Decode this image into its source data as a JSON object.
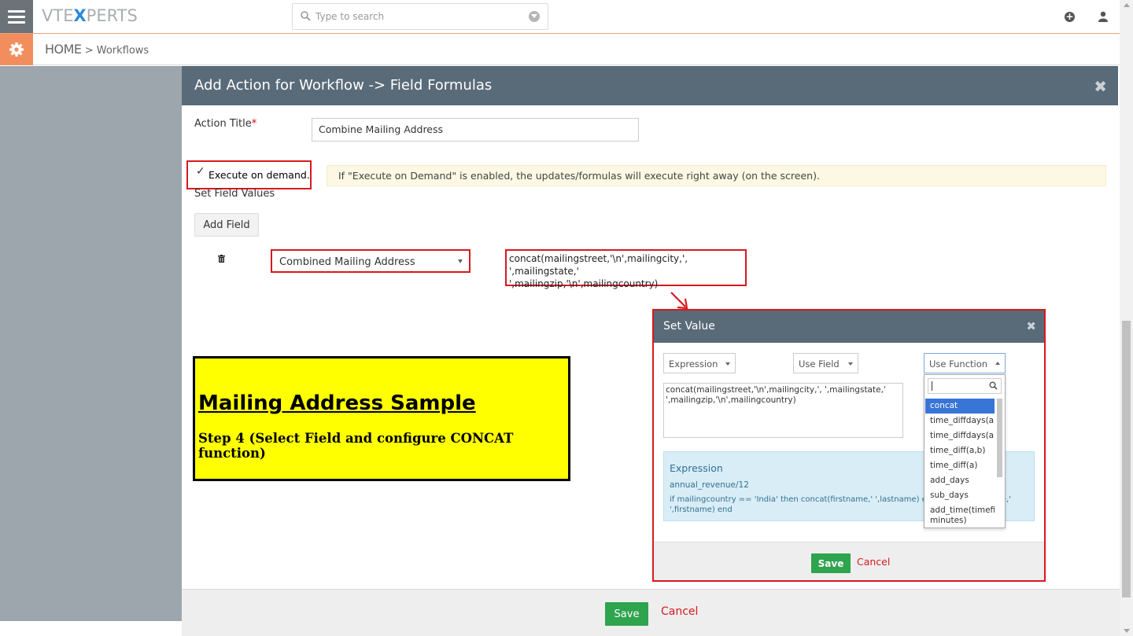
{
  "header": {
    "logo_part1": "VTE",
    "logo_part2": "X",
    "logo_part3": "PERTS",
    "search_placeholder": "Type to search"
  },
  "breadcrumb": {
    "home": "HOME",
    "separator": ">",
    "current": "Workflows"
  },
  "modal": {
    "title": "Add Action for Workflow -> Field Formulas",
    "close_icon": "times-icon",
    "action_title_label": "Action Title",
    "required_marker": "*",
    "action_title_value": "Combine Mailing Address",
    "execute_on_demand_label": "Execute on demand.",
    "execute_on_demand_checked": true,
    "execute_note": "If \"Execute on Demand\" is enabled, the updates/formulas will execute right away (on the screen).",
    "set_field_values_label": "Set Field Values",
    "add_field_button": "Add Field",
    "field_select_value": "Combined Mailing Address",
    "formula_line1": "concat(mailingstreet,'\\n',mailingcity,', ',mailingstate,' ",
    "formula_line2": "',mailingzip,'\\n',mailingcountry)"
  },
  "sample_box": {
    "title": "Mailing Address Sample",
    "step": "Step 4 (Select Field and configure CONCAT function)"
  },
  "set_value_dialog": {
    "title": "Set Value",
    "select_expression": "Expression",
    "select_use_field": "Use Field",
    "select_use_function": "Use Function",
    "textarea_line1": "concat(mailingstreet,'\\n',mailingcity,', ',mailingstate,'",
    "textarea_line2": "',mailingzip,'\\n',mailingcountry)",
    "help_heading": "Expression",
    "help_example1": "annual_revenue/12",
    "help_example2": "if mailingcountry == 'India' then concat(firstname,' ',lastname) else concat(lastname,' ',firstname) end",
    "save_button": "Save",
    "cancel_button": "Cancel",
    "function_options": [
      "concat",
      "time_diffdays(a,b)",
      "time_diffdays(a)",
      "time_diff(a,b)",
      "time_diff(a)",
      "add_days",
      "sub_days",
      "add_time(timefield, minutes)"
    ],
    "selected_function": "concat"
  },
  "footer": {
    "save_button": "Save",
    "cancel_button": "Cancel"
  },
  "colors": {
    "header_bar": "#596a78",
    "accent_orange": "#f28e5e",
    "save_green": "#2ea44f",
    "annotation_red": "#d7191f",
    "sample_yellow": "#ffff00"
  }
}
